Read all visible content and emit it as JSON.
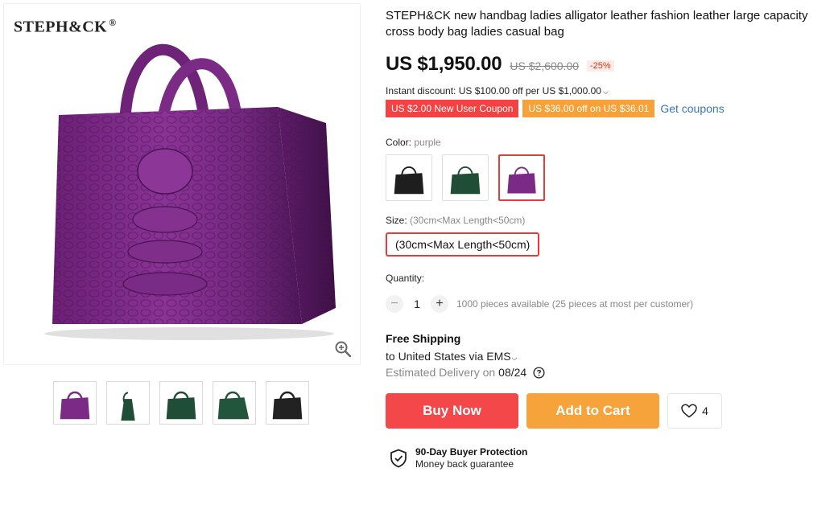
{
  "gallery": {
    "brand": "STEPH&CK",
    "brand_mark": "®",
    "zoom_icon": "magnifier-icon",
    "thumbnails": [
      {
        "color": "#7b2a86",
        "name": "purple-front"
      },
      {
        "color": "#1f4d35",
        "name": "green-side"
      },
      {
        "color": "#1f4d35",
        "name": "green-front"
      },
      {
        "color": "#22553a",
        "name": "green-angle"
      },
      {
        "color": "#222222",
        "name": "black-front"
      }
    ]
  },
  "product": {
    "title": "STEPH&CK new handbag ladies alligator leather fashion leather large capacity cross body bag ladies casual bag",
    "price": "US $1,950.00",
    "old_price": "US $2,600.00",
    "discount": "-25%",
    "instant_discount": "Instant discount: US $100.00 off per US $1,000.00",
    "coupons": [
      {
        "label": "US $2.00 New User Coupon",
        "color": "#f44242"
      },
      {
        "label": "US $36.00 off on US $36.01",
        "color": "#f7a239"
      }
    ],
    "get_coupons": "Get coupons"
  },
  "options": {
    "color_label": "Color: ",
    "color_value": "purple",
    "colors": [
      {
        "color": "#1e1e1e",
        "selected": false
      },
      {
        "color": "#1f4d35",
        "selected": false
      },
      {
        "color": "#7b2a86",
        "selected": true
      }
    ],
    "size_label": "Size: ",
    "size_value": "(30cm<Max Length<50cm)",
    "size_option": "(30cm<Max Length<50cm)"
  },
  "quantity": {
    "label": "Quantity:",
    "minus": "−",
    "value": "1",
    "plus": "+",
    "available": "1000 pieces available (25 pieces at most per customer)"
  },
  "shipping": {
    "title": "Free Shipping",
    "to": "to United States via EMS",
    "delivery_prefix": "Estimated Delivery on",
    "delivery_date": "08/24"
  },
  "actions": {
    "buy_now": "Buy Now",
    "add_to_cart": "Add to Cart",
    "wishlist_count": "4"
  },
  "protection": {
    "title": "90-Day Buyer Protection",
    "subtitle": "Money back guarantee"
  },
  "colors": {
    "accent_red": "#f44749",
    "accent_orange": "#f7a33c",
    "link_blue": "#3a76b7",
    "bag_purple": "#7b2a86"
  }
}
